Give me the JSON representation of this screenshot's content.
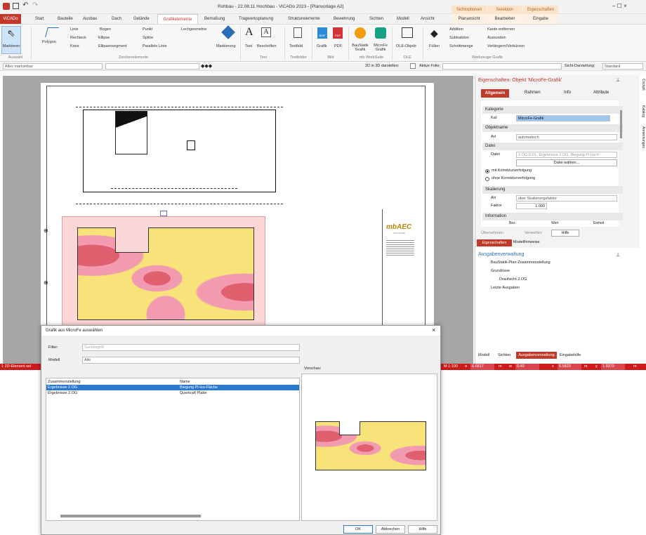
{
  "window": {
    "title": "Rohbau - 22.08.11 Hochbau - ViCADo 2023 - [Planvorlage A2]",
    "help": "? - ⌃ ×",
    "ctrl": "–  ☐  ×"
  },
  "ctx_tabs": {
    "sichtoptionen": "Sichtoptionen",
    "selektion": "Selektion",
    "eigenschaften": "Eigenschaften",
    "planansicht": "Planansicht",
    "bearbeiten": "Bearbeiten",
    "eingabe": "Eingabe"
  },
  "tabs": [
    "ViCADo",
    "Start",
    "Bauteile",
    "Ausbau",
    "Dach",
    "Gelände",
    "Grafikelemente",
    "Bemaßung",
    "Tragwerksplanung",
    "Strukturelemente",
    "Bewehrung",
    "Sichten",
    "Modell",
    "Ansicht"
  ],
  "ribbon": {
    "markieren": "Markieren",
    "polygon": "Polygon",
    "linie": "Linie",
    "rechteck": "Rechteck",
    "kreis": "Kreis",
    "bogen": "Bogen",
    "ellipse": "Ellipse",
    "ellipsensegment": "Ellipsensegment",
    "punkt": "Punkt",
    "spline": "Spline",
    "parallele_linie": "Parallele Linie",
    "lochgeometrie": "Lochgeometrie",
    "markierung": "Markierung",
    "text": "Text",
    "beschriften": "Beschriften",
    "textfeld": "Textfeld",
    "grafik": "Grafik",
    "pdf": "PDF",
    "baustatik_grafik": "BauStatik Grafik",
    "microfe_grafik": "MicroFe Grafik",
    "ole_objekt": "OLE-Objekt",
    "fuellen": "Füllen",
    "addition": "Addition",
    "subtraktion": "Subtraktion",
    "schnittmenge": "Schnittmenge",
    "kante_entfernen": "Kante entfernen",
    "ausrunden": "Ausrunden",
    "verlaengern": "Verlängern/Verkürzen",
    "groups": {
      "auswahl": "Auswahl",
      "zeichenelemente": "Zeichenelemente",
      "text": "Text",
      "textfelder": "Textfelder",
      "bild": "Bild",
      "worksuite": "mb WorkSuite",
      "ole": "OLE",
      "werkzeuge": "Werkzeuge Grafik"
    }
  },
  "toolbar": {
    "alles_markierbar": "Alles markierbar",
    "d2in3d": "2D in 3D darstellen:",
    "aktive_folie": "Aktive Folie:",
    "sicht_darstellung": "Sicht-Darstellung:",
    "standard": "Standard"
  },
  "properties": {
    "title": "Eigenschaften: Objekt 'MicroFe-Grafik'",
    "tabs": [
      "Allgemein",
      "Rahmen",
      "Info",
      "Attribute"
    ],
    "sections": {
      "kategorie": "Kategorie",
      "objektname": "Objektname",
      "datei": "Datei",
      "skalierung": "Skalierung",
      "information": "Information"
    },
    "kat_label": "Kat",
    "kat_value": "MicroFe-Grafik",
    "art_label": "Art",
    "art_value": "automatisch",
    "datei_label": "Datei",
    "datei_value": "2.OG.D.01, Ergebnisse 2.OG, Biegung Pl-Iso-F",
    "datei_button": "Datei wählen...",
    "radio1": "mit Korrekturverfolgung",
    "radio2": "ohne Korrekturverfolgung",
    "skal_art_label": "Art",
    "skal_art_value": "über Skalierungsfaktor",
    "faktor_label": "Faktor",
    "faktor_value": "1.000",
    "info_cols": [
      "Bez.",
      "Wert",
      "Einheit"
    ],
    "actions": [
      "Übernehmen",
      "Verwerfen",
      "Hilfe"
    ],
    "bottom_tabs": [
      "Eigenschaften",
      "Modellhinweise"
    ]
  },
  "side_tabs": [
    "Cockpit",
    "Katalog",
    "Anmerkungen"
  ],
  "ausgaben": {
    "title": "Ausgabenverwaltung",
    "items": [
      "BauStatik-Plan-Zusammenstellung",
      "Grundrisse",
      "Draufsicht 2.OG",
      "Letzte Ausgaben"
    ],
    "bottom_tabs": [
      "Modell",
      "Sichten",
      "Ausgabenverwaltung",
      "Eingabehilfe"
    ]
  },
  "titleblock": {
    "logo": "mbAEC",
    "sub": "SOFTWARE"
  },
  "status": {
    "left": "1 2D-Element sel",
    "scale": "M 1:100",
    "a_label": "α",
    "a_val": "6.6817",
    "m_label": "m",
    "w_label": "w",
    "w_val": "0.40",
    "x_label": "x",
    "x_val": "6.5823",
    "m2_label": "m",
    "y_label": "y",
    "y_val": "1.9379",
    "end": "m"
  },
  "dialog": {
    "title": "Grafik aus MicroFe auswählen",
    "filter_label": "Filter:",
    "filter_placeholder": "Suchbegriff",
    "modell_label": "Modell",
    "modell_value": "Alle",
    "vorschau": "Vorschau:",
    "col1": "Zusammenstellung",
    "col2": "Name",
    "rows": [
      {
        "a": "Ergebnisse 2.OG",
        "b": "Biegung Pl-Iso-Fläche"
      },
      {
        "a": "Ergebnisse 2.OG",
        "b": "Querkraft Platte"
      }
    ],
    "ok": "OK",
    "abbrechen": "Abbrechen",
    "hilfe": "Hilfe"
  }
}
